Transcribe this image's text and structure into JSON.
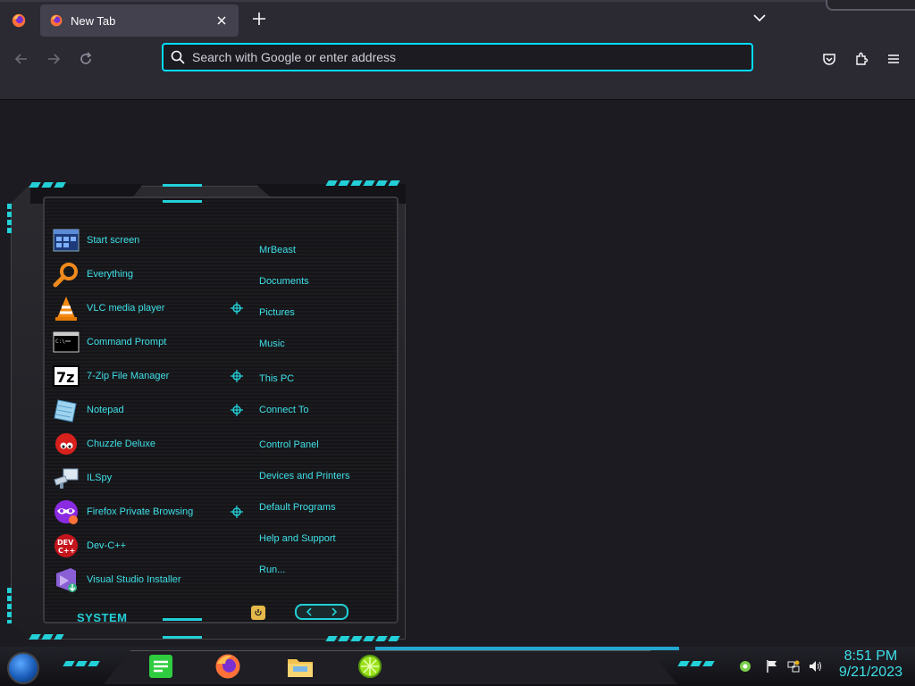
{
  "browser": {
    "tab_title": "New Tab",
    "url_placeholder": "Search with Google or enter address"
  },
  "start_menu": {
    "programs": [
      {
        "label": "Start screen",
        "icon": "start-screen-icon",
        "has_arrow": false
      },
      {
        "label": "Everything",
        "icon": "magnifier-icon",
        "has_arrow": false
      },
      {
        "label": "VLC media player",
        "icon": "vlc-cone-icon",
        "has_arrow": true
      },
      {
        "label": "Command Prompt",
        "icon": "cmd-icon",
        "has_arrow": false
      },
      {
        "label": "7-Zip File Manager",
        "icon": "7zip-icon",
        "has_arrow": true
      },
      {
        "label": "Notepad",
        "icon": "notepad-icon",
        "has_arrow": true
      },
      {
        "label": "Chuzzle Deluxe",
        "icon": "chuzzle-icon",
        "has_arrow": false
      },
      {
        "label": "ILSpy",
        "icon": "ilspy-icon",
        "has_arrow": false
      },
      {
        "label": "Firefox Private Browsing",
        "icon": "private-browsing-icon",
        "has_arrow": true
      },
      {
        "label": "Dev-C++",
        "icon": "devcpp-icon",
        "has_arrow": false
      },
      {
        "label": "Visual Studio Installer",
        "icon": "vs-installer-icon",
        "has_arrow": false
      }
    ],
    "places": [
      {
        "label": "MrBeast"
      },
      {
        "label": "Documents"
      },
      {
        "label": "Pictures"
      },
      {
        "label": "Music"
      },
      {
        "label": "This PC"
      },
      {
        "label": "Connect To"
      },
      {
        "label": "Control Panel"
      },
      {
        "label": "Devices and Printers"
      },
      {
        "label": "Default Programs"
      },
      {
        "label": "Help and Support"
      },
      {
        "label": "Run..."
      }
    ],
    "system_label": "SYSTEM"
  },
  "taskbar": {
    "apps": [
      "notes-icon",
      "firefox-icon",
      "file-explorer-icon",
      "lime-icon"
    ],
    "clock_time": "8:51 PM",
    "clock_date": "9/21/2023"
  },
  "colors": {
    "accent": "#23d0d8",
    "menu_text": "#3ee0e8",
    "url_focus": "#00ddff"
  }
}
